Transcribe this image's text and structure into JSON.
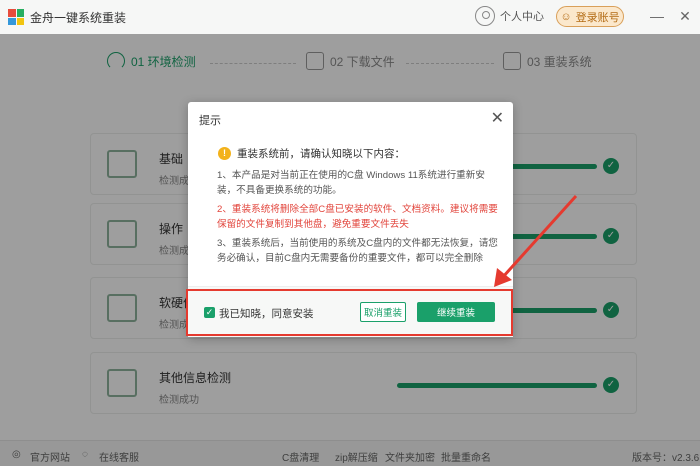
{
  "app": {
    "title": "金舟一键系统重装",
    "user_center": "个人中心",
    "login_label": "登录账号",
    "minimize": "—",
    "close": "✕"
  },
  "steps": [
    {
      "label": "01 环境检测",
      "icon": "gauge-icon",
      "active": true
    },
    {
      "label": "02 下载文件",
      "icon": "download-file-icon",
      "active": false
    },
    {
      "label": "03 重装系统",
      "icon": "reinstall-icon",
      "active": false
    }
  ],
  "cards": [
    {
      "title": "基础",
      "subtitle": "检测成",
      "icon": "monitor-icon",
      "status": "done"
    },
    {
      "title": "操作",
      "subtitle": "检测成",
      "icon": "grid-icon",
      "status": "done"
    },
    {
      "title": "软硬件",
      "subtitle": "检测成",
      "icon": "code-icon",
      "status": "done"
    },
    {
      "title": "其他信息检测",
      "subtitle": "检测成功",
      "icon": "document-icon",
      "status": "done"
    }
  ],
  "footer": {
    "website": "官方网站",
    "support": "在线客服",
    "c_clean": "C盘清理",
    "zip": "zip解压缩",
    "encrypt": "文件夹加密",
    "rename": "批量重命名",
    "version": "版本号：v2.3.6"
  },
  "dialog": {
    "title": "提示",
    "close": "✕",
    "warning": "重装系统前，请确认知晓以下内容：",
    "para1": "1、本产品是对当前正在使用的C盘 Windows 11系统进行重新安装，不具备更换系统的功能。",
    "para2": "2、重装系统将删除全部C盘已安装的软件、文档资料。建议将需要保留的文件复制到其他盘，避免重要文件丢失",
    "para3": "3、重装系统后，当前使用的系统及C盘内的文件都无法恢复，请您务必确认，目前C盘内无需要备份的重要文件，都可以完全删除",
    "agree": "我已知晓，同意安装",
    "cancel": "取消重装",
    "continue": "继续重装"
  },
  "colors": {
    "accent": "#1aa06a",
    "warning": "#f3b21b",
    "danger": "#e2453c",
    "annotation": "#e53a2f"
  }
}
